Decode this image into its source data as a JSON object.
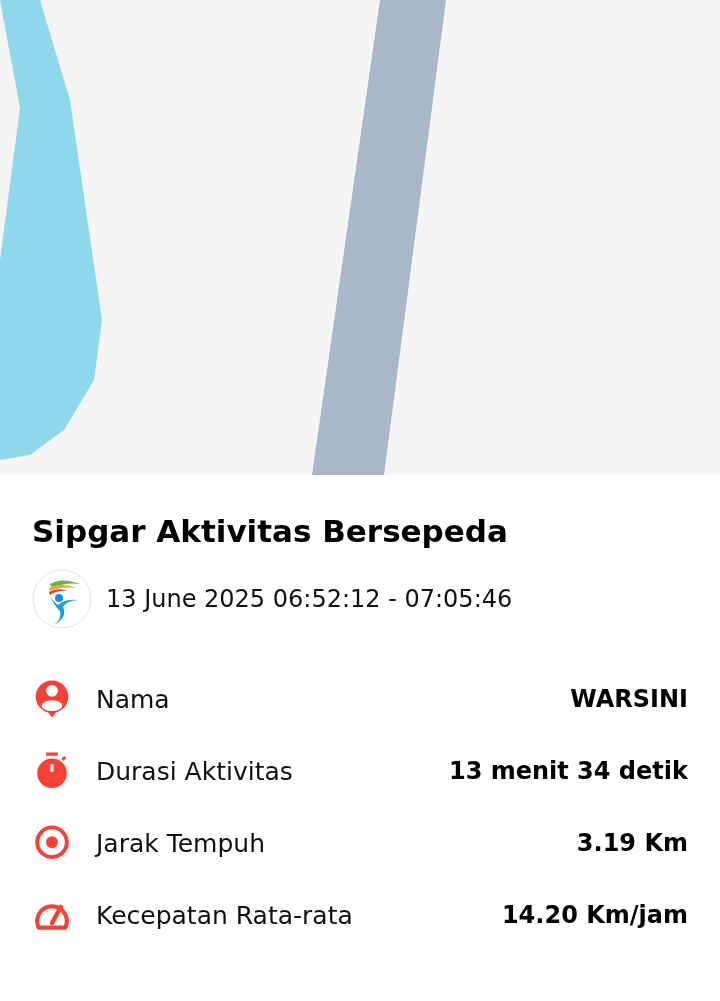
{
  "title": "Sipgar Aktivitas Bersepeda",
  "time_range": "13 June 2025 06:52:12 - 07:05:46",
  "stats": [
    {
      "kind": "person",
      "label": "Nama",
      "value": "WARSINI"
    },
    {
      "kind": "stopwatch",
      "label": "Durasi Aktivitas",
      "value": "13 menit 34 detik"
    },
    {
      "kind": "target",
      "label": "Jarak Tempuh",
      "value": "3.19 Km"
    },
    {
      "kind": "gauge",
      "label": "Kecepatan Rata-rata",
      "value": "14.20 Km/jam"
    }
  ]
}
